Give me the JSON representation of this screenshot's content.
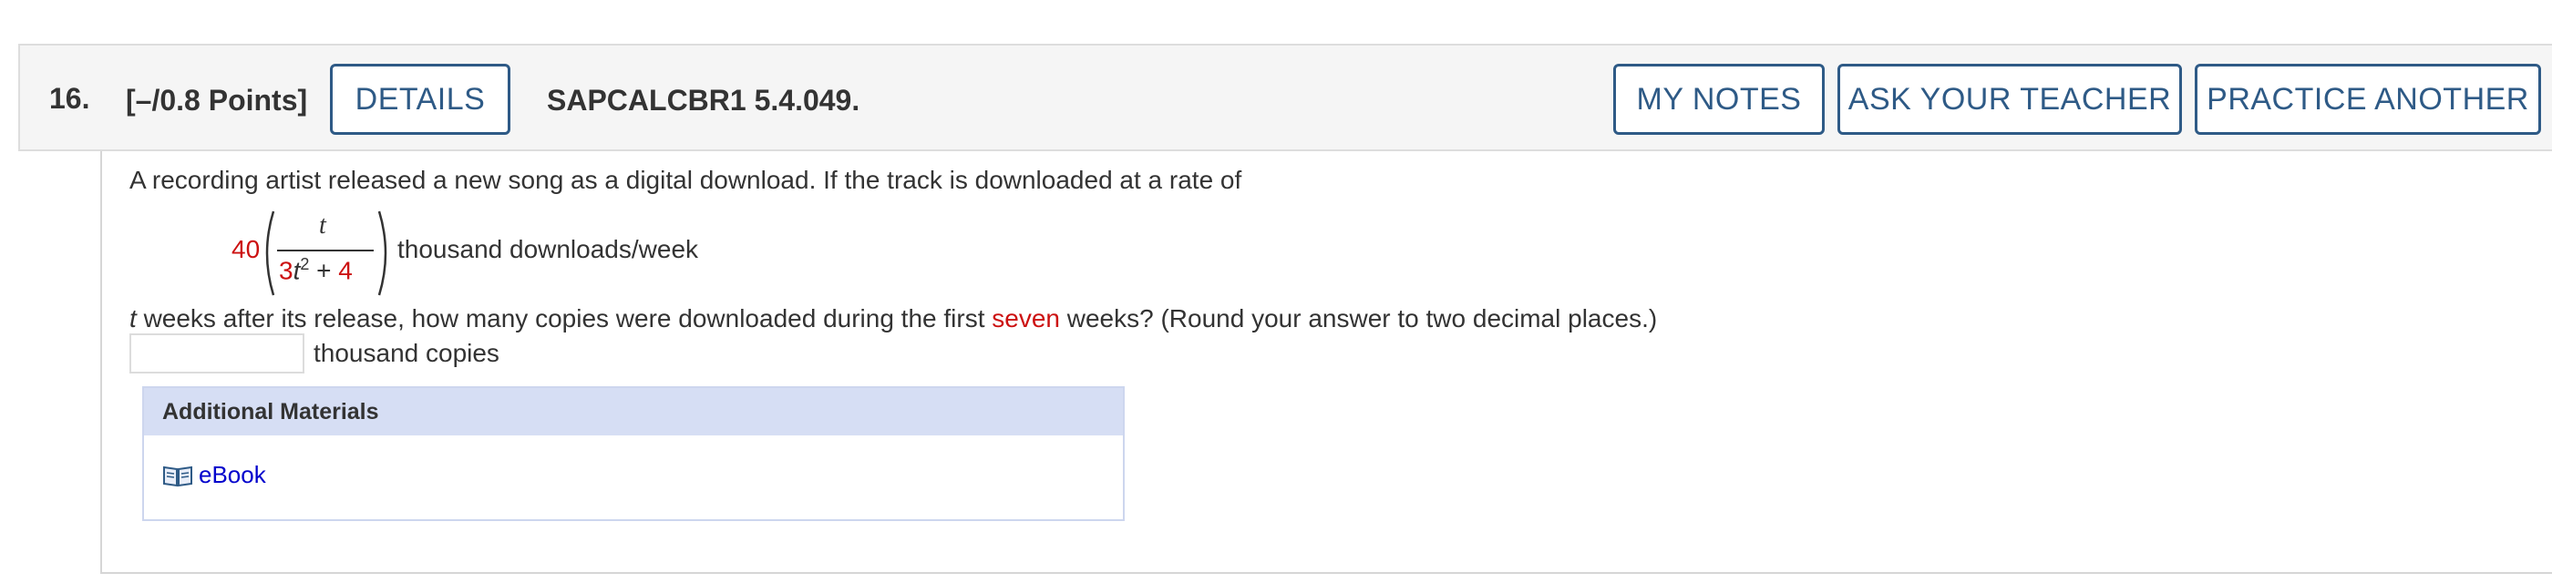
{
  "header": {
    "question_number": "16.",
    "points": "[–/0.8 Points]",
    "details_label": "DETAILS",
    "question_code": "SAPCALCBR1 5.4.049.",
    "my_notes_label": "MY NOTES",
    "ask_teacher_label": "ASK YOUR TEACHER",
    "practice_another_label": "PRACTICE ANOTHER"
  },
  "question": {
    "intro": "A recording artist released a new song as a digital download. If the track is downloaded at a rate of",
    "rate": {
      "coefficient": "40",
      "numerator": "t",
      "denominator_coef": "3",
      "denominator_var": "t",
      "denominator_exp": "2",
      "denominator_plus": "+",
      "denominator_const": "4",
      "units": "thousand downloads/week"
    },
    "line2_var": "t",
    "line2_before": "weeks after its release, how many copies were downloaded during the first",
    "line2_highlight": "seven",
    "line2_after": "weeks? (Round your answer to two decimal places.)",
    "answer_units": "thousand copies",
    "answer_value": ""
  },
  "additional_materials": {
    "title": "Additional Materials",
    "ebook_label": "eBook"
  },
  "colors": {
    "accent_blue": "#2e5a86",
    "highlight_red": "#cc1111",
    "link_blue": "#0000cc",
    "panel_header": "#d6def4"
  }
}
